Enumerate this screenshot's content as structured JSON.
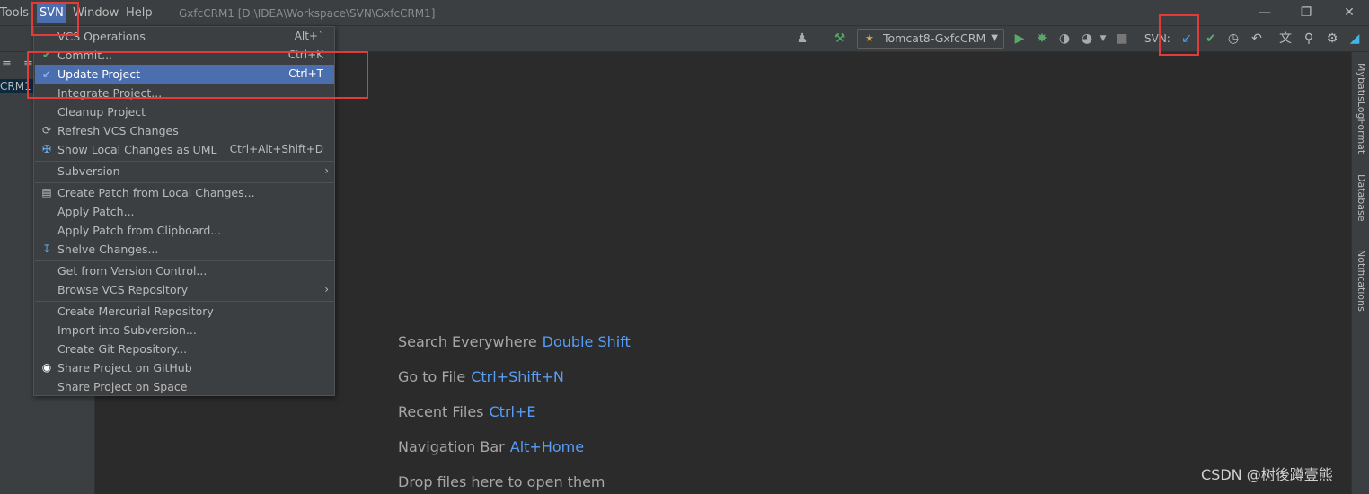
{
  "menubar": {
    "tools": "Tools",
    "svn": "SVN",
    "window": "Window",
    "help": "Help",
    "title": "GxfcCRM1 [D:\\IDEA\\Workspace\\SVN\\GxfcCRM1]"
  },
  "toolbar": {
    "run_config": "Tomcat8-GxfcCRM",
    "svn_label": "SVN:"
  },
  "left_panel": {
    "project_label": "CRM1"
  },
  "right_strip": {
    "mybatis": "MybatisLogFormat",
    "database": "Database",
    "notifications": "Notifications"
  },
  "svn_menu": {
    "items": [
      {
        "label": "VCS Operations",
        "shortcut": "Alt+`"
      },
      {
        "label": "Commit...",
        "shortcut": "Ctrl+K"
      },
      {
        "label": "Update Project",
        "shortcut": "Ctrl+T"
      },
      {
        "label": "Integrate Project..."
      },
      {
        "label": "Cleanup Project"
      },
      {
        "label": "Refresh VCS Changes"
      },
      {
        "label": "Show Local Changes as UML",
        "shortcut": "Ctrl+Alt+Shift+D"
      },
      {
        "label": "Subversion"
      },
      {
        "label": "Create Patch from Local Changes..."
      },
      {
        "label": "Apply Patch..."
      },
      {
        "label": "Apply Patch from Clipboard..."
      },
      {
        "label": "Shelve Changes..."
      },
      {
        "label": "Get from Version Control..."
      },
      {
        "label": "Browse VCS Repository"
      },
      {
        "label": "Create Mercurial Repository"
      },
      {
        "label": "Import into Subversion..."
      },
      {
        "label": "Create Git Repository..."
      },
      {
        "label": "Share Project on GitHub"
      },
      {
        "label": "Share Project on Space"
      }
    ]
  },
  "hints": [
    {
      "label": "Search Everywhere",
      "key": "Double Shift"
    },
    {
      "label": "Go to File",
      "key": "Ctrl+Shift+N"
    },
    {
      "label": "Recent Files",
      "key": "Ctrl+E"
    },
    {
      "label": "Navigation Bar",
      "key": "Alt+Home"
    },
    {
      "label": "Drop files here to open them"
    }
  ],
  "watermark": "CSDN @树後蹲壹熊"
}
